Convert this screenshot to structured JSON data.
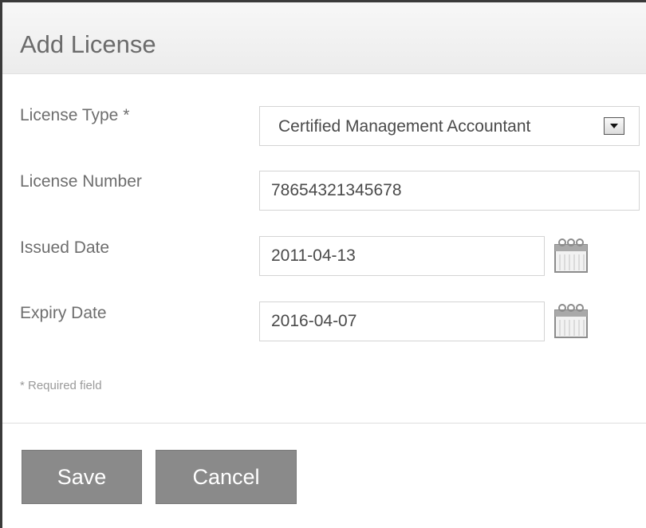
{
  "dialog": {
    "title": "Add License"
  },
  "form": {
    "license_type": {
      "label": "License Type *",
      "value": "Certified Management Accountant"
    },
    "license_number": {
      "label": "License Number",
      "value": "78654321345678"
    },
    "issued_date": {
      "label": "Issued Date",
      "value": "2011-04-13",
      "icon": "calendar-icon"
    },
    "expiry_date": {
      "label": "Expiry Date",
      "value": "2016-04-07",
      "icon": "calendar-icon"
    },
    "required_note": "* Required field"
  },
  "actions": {
    "save_label": "Save",
    "cancel_label": "Cancel"
  },
  "colors": {
    "button_bg": "#8a8a8a",
    "label_text": "#6e6e6e",
    "header_bg": "#f0f0f0"
  }
}
